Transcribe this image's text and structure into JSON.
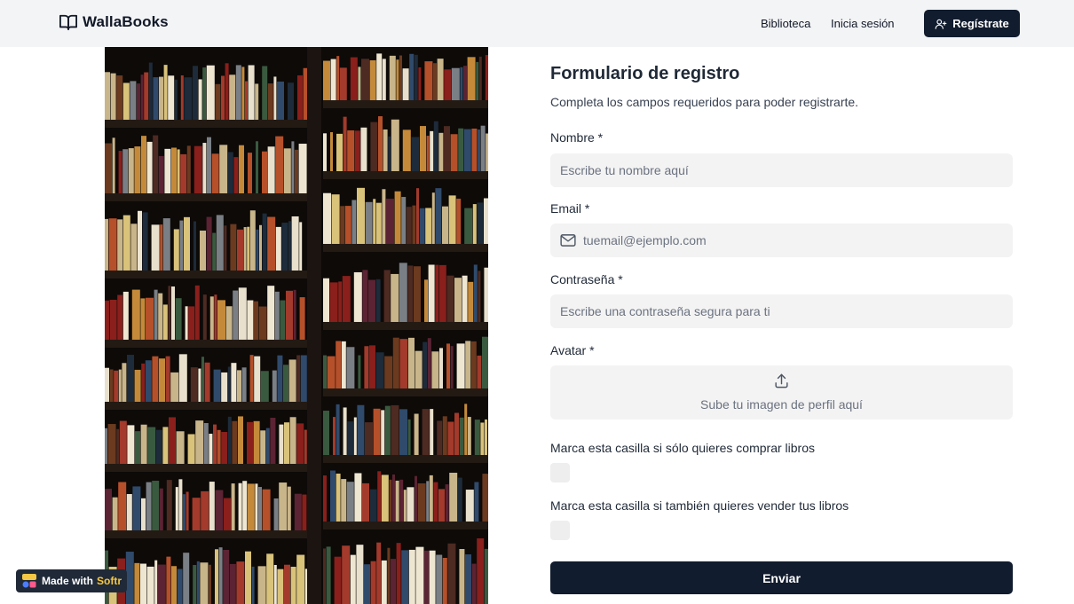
{
  "navbar": {
    "brand": "WallaBooks",
    "links": [
      "Biblioteca",
      "Inicia sesión"
    ],
    "signup_label": "Regístrate"
  },
  "form": {
    "title": "Formulario de registro",
    "subtitle": "Completa los campos requeridos para poder registrarte.",
    "name": {
      "label": "Nombre *",
      "placeholder": "Escribe tu nombre aquí"
    },
    "email": {
      "label": "Email *",
      "placeholder": "tuemail@ejemplo.com"
    },
    "password": {
      "label": "Contraseña *",
      "placeholder": "Escribe una contraseña segura para ti"
    },
    "avatar": {
      "label": "Avatar *",
      "upload_text": "Sube tu imagen de perfil aquí"
    },
    "buy_only_label": "Marca esta casilla si sólo quieres comprar libros",
    "also_sell_label": "Marca esta casilla si también quieres vender tus libros",
    "submit_label": "Enviar"
  },
  "badge": {
    "prefix": "Made with",
    "brand": "Softr"
  },
  "colors": {
    "primary": "#111c2e",
    "navbar_bg": "#f3f4f6",
    "input_bg": "#f3f3f3",
    "badge_accent": "#f6c744"
  },
  "icons": {
    "brand": "book-open-icon",
    "signup": "user-plus-icon",
    "email": "mail-icon",
    "upload": "upload-icon"
  }
}
